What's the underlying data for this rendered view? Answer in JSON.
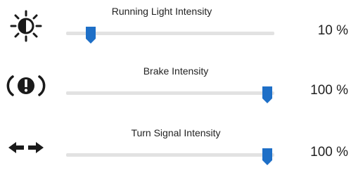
{
  "accent_color": "#1e6fc7",
  "controls": [
    {
      "icon": "running-light-icon",
      "label": "Running Light Intensity",
      "value": 10,
      "value_text": "10 %"
    },
    {
      "icon": "brake-warning-icon",
      "label": "Brake Intensity",
      "value": 100,
      "value_text": "100 %"
    },
    {
      "icon": "turn-signal-icon",
      "label": "Turn Signal Intensity",
      "value": 100,
      "value_text": "100 %"
    }
  ]
}
